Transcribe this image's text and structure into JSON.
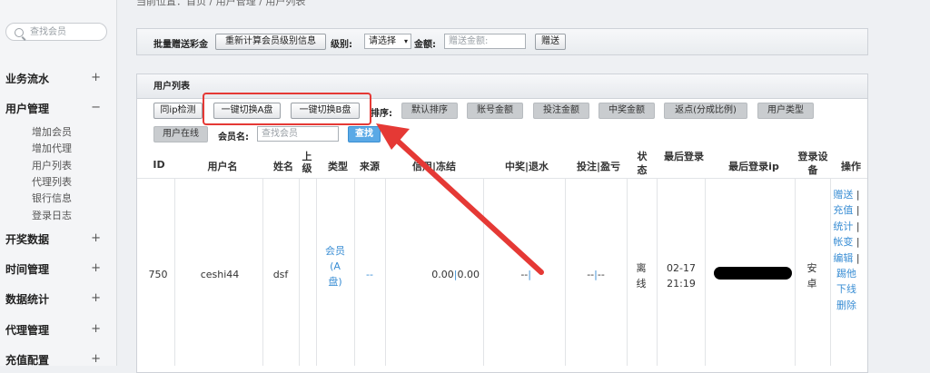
{
  "breadcrumb": "当前位置：首页 / 用户管理 / 用户列表",
  "sidebar": {
    "search_placeholder": "查找会员",
    "sections": [
      {
        "label": "业务流水",
        "toggle": "+"
      },
      {
        "label": "用户管理",
        "toggle": "−"
      },
      {
        "label": "开奖数据",
        "toggle": "+"
      },
      {
        "label": "时间管理",
        "toggle": "+"
      },
      {
        "label": "数据统计",
        "toggle": "+"
      },
      {
        "label": "代理管理",
        "toggle": "+"
      },
      {
        "label": "充值配置",
        "toggle": "+"
      }
    ],
    "user_mgmt_items": [
      "增加会员",
      "增加代理",
      "用户列表",
      "代理列表",
      "银行信息",
      "登录日志"
    ]
  },
  "toolbar": {
    "batch_label": "批量赠送彩金",
    "recalc_button": "重新计算会员级别信息",
    "level_label": "级别:",
    "level_select": "请选择",
    "amount_label": "金额:",
    "amount_placeholder": "赠送金额:",
    "gift_button": "赠送"
  },
  "user_list": {
    "title": "用户列表",
    "ip_check": "同ip检测",
    "switch_a": "一键切换A盘",
    "switch_b": "一键切换B盘",
    "sort_label": "排序:",
    "sort_buttons": [
      "默认排序",
      "账号金额",
      "投注金额",
      "中奖金额",
      "返点(分成比例)",
      "用户类型"
    ],
    "online_button": "用户在线",
    "member_label": "会员名:",
    "member_placeholder": "查找会员",
    "search_button": "查找",
    "columns": [
      "ID",
      "用户名",
      "姓名",
      "上级",
      "类型",
      "来源",
      "信用|冻结",
      "中奖|退水",
      "投注|盈亏",
      "状态",
      "最后登录",
      "最后登录ip",
      "登录设备",
      "操作"
    ],
    "row": {
      "id": "750",
      "username": "ceshi44",
      "name": "dsf",
      "type": "会员(A盘)",
      "source": "--",
      "credit": "0.00",
      "frozen": "0.00",
      "win": "--",
      "bet": "--",
      "profit": "--",
      "status": "离线",
      "last_login": "02-17 21:19",
      "device": "安卓",
      "actions": [
        "赠送",
        "充值",
        "统计",
        "帐变",
        "编辑",
        "踢他下线",
        "删除"
      ]
    }
  },
  "colors": {
    "highlight": "#e53935",
    "link": "#3a8ed4",
    "search_button": "#5aa9e6"
  }
}
